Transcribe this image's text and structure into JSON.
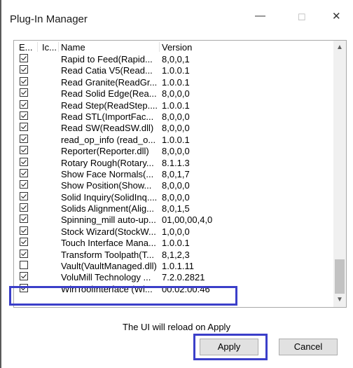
{
  "window": {
    "title": "Plug-In Manager"
  },
  "columns": {
    "enabled": "E...",
    "icon": "Ic...",
    "name": "Name",
    "version": "Version"
  },
  "plugins": [
    {
      "checked": true,
      "name": "Rapid to Feed(Rapid...",
      "version": "8,0,0,1"
    },
    {
      "checked": true,
      "name": "Read Catia V5(Read...",
      "version": "1.0.0.1"
    },
    {
      "checked": true,
      "name": "Read Granite(ReadGr...",
      "version": "1.0.0.1"
    },
    {
      "checked": true,
      "name": "Read Solid Edge(Rea...",
      "version": "8,0,0,0"
    },
    {
      "checked": true,
      "name": "Read Step(ReadStep....",
      "version": "1.0.0.1"
    },
    {
      "checked": true,
      "name": "Read STL(ImportFac...",
      "version": "8,0,0,0"
    },
    {
      "checked": true,
      "name": "Read SW(ReadSW.dll)",
      "version": "8,0,0,0"
    },
    {
      "checked": true,
      "name": "read_op_info (read_o...",
      "version": "1.0.0.1"
    },
    {
      "checked": true,
      "name": "Reporter(Reporter.dll)",
      "version": "8,0,0,0"
    },
    {
      "checked": true,
      "name": "Rotary Rough(Rotary...",
      "version": "8.1.1.3"
    },
    {
      "checked": true,
      "name": "Show Face Normals(...",
      "version": "8,0,1,7"
    },
    {
      "checked": true,
      "name": "Show Position(Show...",
      "version": "8,0,0,0"
    },
    {
      "checked": true,
      "name": "Solid Inquiry(SolidInq....",
      "version": "8,0,0,0"
    },
    {
      "checked": true,
      "name": "Solids Alignment(Alig...",
      "version": "8,0,1,5"
    },
    {
      "checked": true,
      "name": "Spinning_mill auto-up...",
      "version": "01,00,00,4,0"
    },
    {
      "checked": true,
      "name": "Stock Wizard(StockW...",
      "version": "1,0,0,0"
    },
    {
      "checked": true,
      "name": "Touch Interface Mana...",
      "version": "1.0.0.1"
    },
    {
      "checked": true,
      "name": "Transform Toolpath(T...",
      "version": "8,1,2,3"
    },
    {
      "checked": false,
      "name": "Vault(VaultManaged.dll)",
      "version": "1.0.1.11"
    },
    {
      "checked": true,
      "name": "VoluMill Technology ...",
      "version": "7.2.0.2821"
    },
    {
      "checked": true,
      "name": "WinToolInterface (Wi...",
      "version": "00.02.00.46"
    }
  ],
  "message": "The UI will reload on Apply",
  "buttons": {
    "apply": "Apply",
    "cancel": "Cancel"
  },
  "icons": {
    "minimize": "—",
    "maximize": "☐",
    "close": "✕",
    "scroll_up": "▲",
    "scroll_down": "▼"
  },
  "colors": {
    "highlight": "#3b3fc9"
  }
}
